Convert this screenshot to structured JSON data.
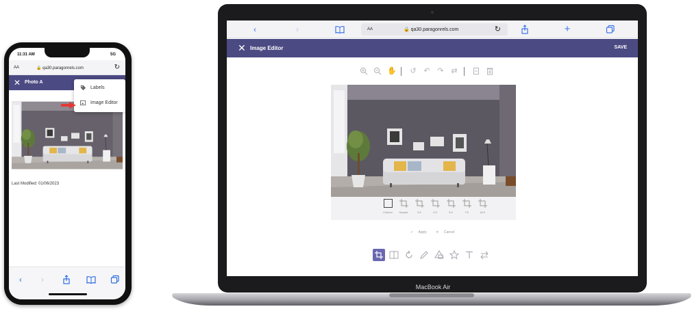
{
  "phone": {
    "status": {
      "time": "11:31 AM",
      "network": "5G"
    },
    "browser": {
      "text_size": "AA",
      "url": "qa30.paragonrels.com"
    },
    "appbar": {
      "title": "Photo A"
    },
    "menu": {
      "items": [
        {
          "label": "Labels",
          "icon": "tag-icon"
        },
        {
          "label": "Image Editor",
          "icon": "image-edit-icon"
        }
      ]
    },
    "last_modified": "Last Modified: 01/06/2023",
    "arrow_color": "#e53935"
  },
  "laptop": {
    "browser": {
      "text_size": "AA",
      "url": "qa30.paragonrels.com"
    },
    "appbar": {
      "title": "Image Editor",
      "save_label": "SAVE",
      "color": "#4c4a83"
    },
    "crop_options": [
      {
        "label": "Custom",
        "selected": true
      },
      {
        "label": "Square"
      },
      {
        "label": "3:2"
      },
      {
        "label": "4:3"
      },
      {
        "label": "5:4"
      },
      {
        "label": "7:5"
      },
      {
        "label": "16:9"
      }
    ],
    "apply_label": "Apply",
    "cancel_label": "Cancel",
    "active_tool": "crop",
    "accent": "#6a67b0",
    "brand_label": "MacBook Air"
  }
}
